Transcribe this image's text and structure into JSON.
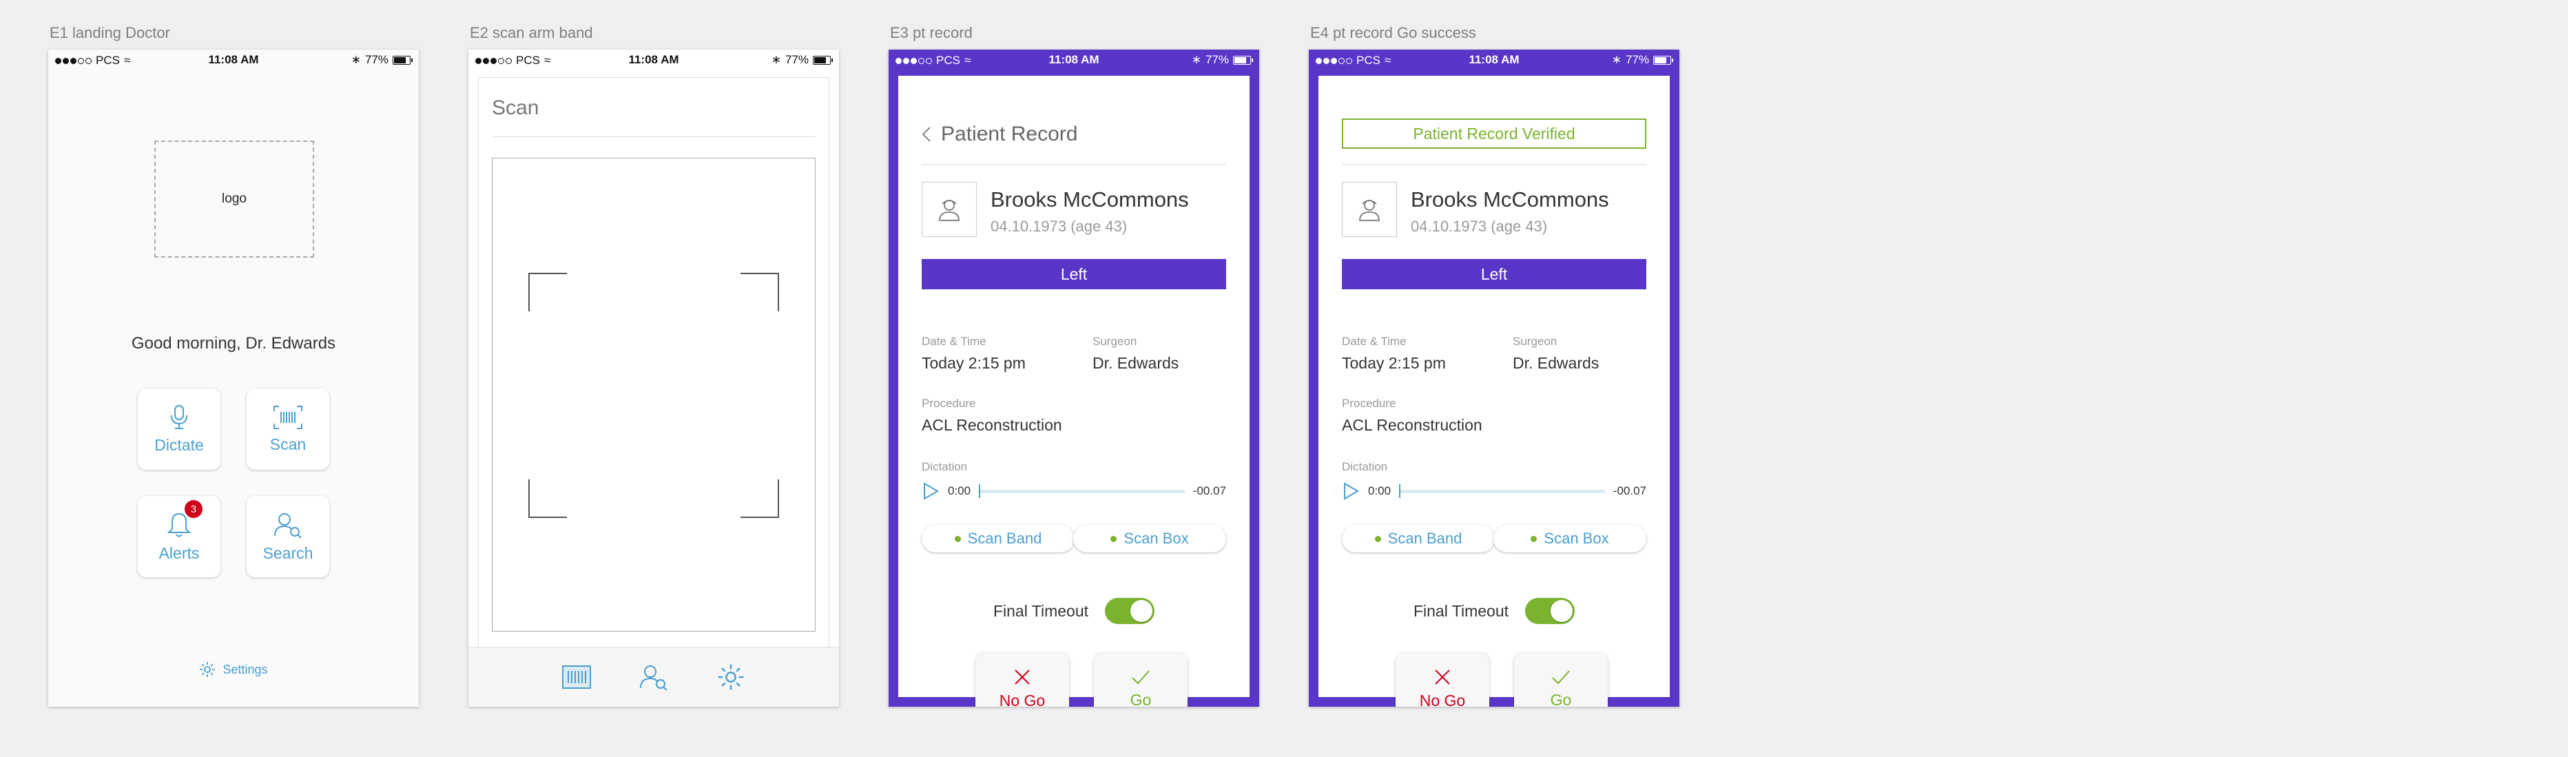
{
  "artboards": [
    {
      "title": "E1 landing Doctor"
    },
    {
      "title": "E2 scan arm band"
    },
    {
      "title": "E3 pt record"
    },
    {
      "title": "E4 pt record Go success"
    }
  ],
  "status_bar": {
    "carrier": "PCS",
    "time": "11:08 AM",
    "battery": "77%"
  },
  "e1": {
    "logo": "logo",
    "greeting": "Good morning, Dr. Edwards",
    "tiles": {
      "dictate": "Dictate",
      "scan": "Scan",
      "alerts": "Alerts",
      "search": "Search"
    },
    "alerts_badge": "3",
    "settings": "Settings",
    "accent": "#4a9fd0"
  },
  "e2": {
    "title": "Scan"
  },
  "record": {
    "title": "Patient Record",
    "verified": "Patient Record Verified",
    "patient_name": "Brooks McCommons",
    "dob": "04.10.1973 (age 43)",
    "side": "Left",
    "date_label": "Date & Time",
    "date_value": "Today 2:15 pm",
    "surgeon_label": "Surgeon",
    "surgeon_value": "Dr. Edwards",
    "procedure_label": "Procedure",
    "procedure_value": "ACL Reconstruction",
    "dictation_label": "Dictation",
    "time_start": "0:00",
    "time_end": "-00.07",
    "scan_band": "Scan Band",
    "scan_box": "Scan Box",
    "final_timeout": "Final Timeout",
    "no_go": "No Go",
    "go": "Go",
    "colors": {
      "purple": "#5a36c8",
      "green": "#7ab32e",
      "red": "#d0021b"
    }
  }
}
